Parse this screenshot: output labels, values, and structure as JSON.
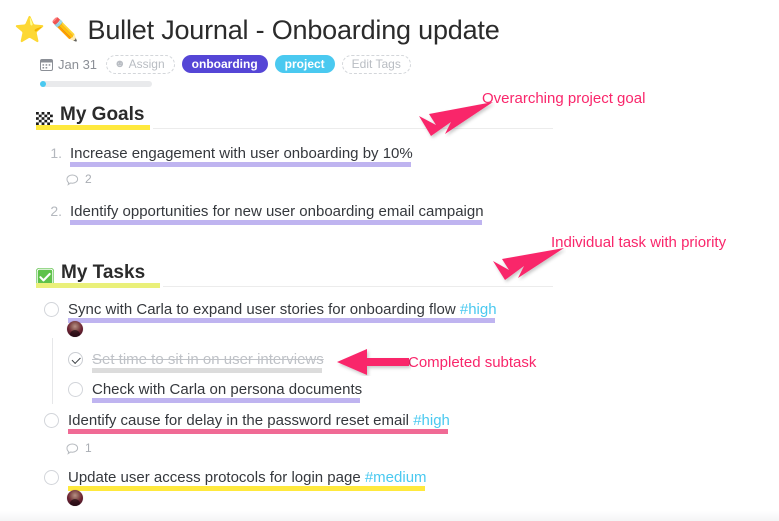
{
  "header": {
    "star_icon": "star-icon",
    "pencil_icon": "pencil-icon",
    "title": "Bullet Journal - Onboarding update",
    "calendar_icon": "calendar-icon",
    "date": "Jan 31",
    "assign_label": "Assign",
    "person_icon": "person-icon",
    "edit_tags_label": "Edit Tags",
    "tags": [
      {
        "label": "onboarding",
        "color": "#5546d6"
      },
      {
        "label": "project",
        "color": "#4ac9f0"
      }
    ],
    "progress": {
      "value": 2,
      "track_color": "#e9eaec",
      "fill_color": "#4ac9f0"
    }
  },
  "sections": [
    {
      "emoji": "checkered-flag-emoji",
      "title": "My Goals",
      "underline_color": "#ffe93d",
      "items": [
        {
          "number": "1.",
          "text": "Increase engagement with user onboarding by 10%",
          "highlight_color": "#bfb4f0",
          "comments": "2"
        },
        {
          "number": "2.",
          "text": "Identify opportunities for new user onboarding email campaign",
          "highlight_color": "#bfb4f0",
          "comments": null
        }
      ]
    },
    {
      "emoji": "white-check-mark-emoji",
      "title": "My Tasks",
      "underline_color": "#eaf07a",
      "items": [
        {
          "text": "Sync with Carla to expand user stories for onboarding flow",
          "priority_tag": "#high",
          "highlight_color": "#bfb4f0",
          "done": false,
          "avatar": true,
          "comments": null,
          "subtasks": [
            {
              "text": "Set time to sit in on user interviews",
              "done": true,
              "highlight_color": "#dcdcdc"
            },
            {
              "text": "Check with Carla on persona documents",
              "done": false,
              "highlight_color": "#bfb4f0"
            }
          ]
        },
        {
          "text": "Identify cause for delay in the password reset email",
          "priority_tag": "#high",
          "highlight_color": "#f06a95",
          "done": false,
          "avatar": false,
          "comments": "1",
          "subtasks": []
        },
        {
          "text": "Update user access protocols for login page",
          "priority_tag": "#medium",
          "highlight_color": "#ffe93d",
          "done": false,
          "avatar": true,
          "comments": null,
          "subtasks": []
        }
      ]
    }
  ],
  "annotations": [
    {
      "text": "Overarching project goal",
      "color": "#f9266b",
      "arrow": "diagonal-down-left"
    },
    {
      "text": "Individual task with priority",
      "color": "#f9266b",
      "arrow": "diagonal-down-left"
    },
    {
      "text": "Completed subtask",
      "color": "#f9266b",
      "arrow": "left"
    }
  ],
  "comment_icon": "comment-bubble-icon"
}
